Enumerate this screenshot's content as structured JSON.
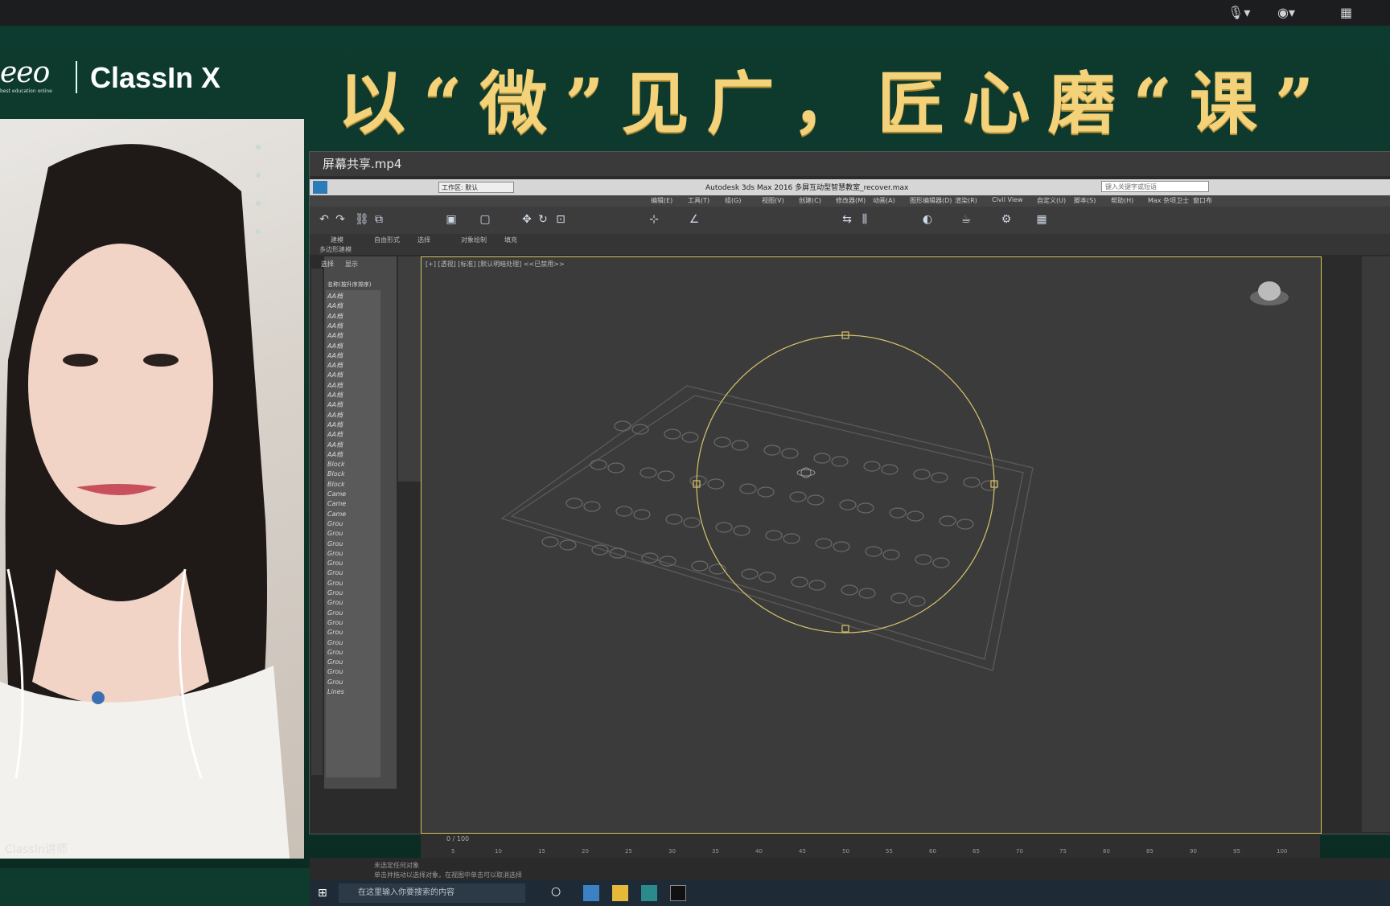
{
  "system_bar": {
    "mic_icon": "microphone-icon",
    "cam_icon": "camera-icon",
    "grid_icon": "grid-icon"
  },
  "branding": {
    "eeo": "eeo",
    "eeo_sub": "best education online",
    "classin": "ClassIn X"
  },
  "slogan": "以“微”见广，匠心磨“课”",
  "video": {
    "caption": "ClassIn讲师"
  },
  "share_window": {
    "title": "屏幕共享.mp4",
    "app_title": "Autodesk 3ds Max 2016    多屏互动型智慧教室_recover.max",
    "search_placeholder": "键入关键字或短语",
    "workspace": "工作区: 默认",
    "menu": [
      "编辑(E)",
      "工具(T)",
      "组(G)",
      "视图(V)",
      "创建(C)",
      "修改器(M)",
      "动画(A)",
      "图形编辑器(D)",
      "渲染(R)",
      "Civil View",
      "自定义(U)",
      "脚本(S)",
      "帮助(H)",
      "Max 杂项卫士",
      "窗口布"
    ],
    "ribbon_tabs": [
      "建模",
      "自由形式",
      "选择",
      "对象绘制",
      "填充"
    ],
    "ribbon_sub": "多边形建模",
    "explorer": {
      "tabs": [
        "选择",
        "显示"
      ],
      "header": "名称(按升序排序)",
      "rows": [
        "AA档",
        "AA档",
        "AA档",
        "AA档",
        "AA档",
        "AA档",
        "AA档",
        "AA档",
        "AA档",
        "AA档",
        "AA档",
        "AA档",
        "AA档",
        "AA档",
        "AA档",
        "AA档",
        "AA档",
        "Block",
        "Block",
        "Block",
        "Came",
        "Came",
        "Came",
        "Grou",
        "Grou",
        "Grou",
        "Grou",
        "Grou",
        "Grou",
        "Grou",
        "Grou",
        "Grou",
        "Grou",
        "Grou",
        "Grou",
        "Grou",
        "Grou",
        "Grou",
        "Grou",
        "Grou",
        "Lines"
      ]
    },
    "viewport_label": "[+] [透视] [标准] [默认明暗处理]  <<已禁用>>",
    "frame_counter": "0 / 100",
    "ticks": [
      "5",
      "10",
      "15",
      "20",
      "25",
      "30",
      "35",
      "40",
      "45",
      "50",
      "55",
      "60",
      "65",
      "70",
      "75",
      "80",
      "85",
      "90",
      "95",
      "100"
    ],
    "status_line1": "未选定任何对象",
    "status_line2": "单击并拖动以选择对象，在视图中单击可以取消选择",
    "taskbar_search": "在这里输入你要搜索的内容"
  },
  "colors": {
    "banner": "#0e3b2f",
    "slogan": "#f4d27a",
    "selection": "#d7c25c"
  }
}
